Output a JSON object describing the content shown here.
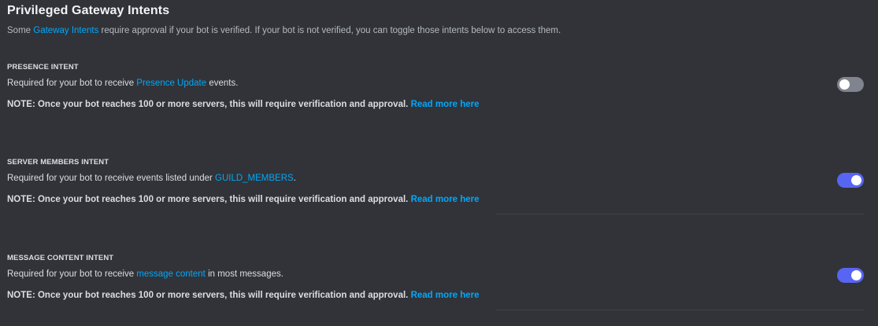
{
  "section": {
    "title": "Privileged Gateway Intents",
    "subtitle_before": "Some ",
    "subtitle_link": "Gateway Intents",
    "subtitle_after": " require approval if your bot is verified. If your bot is not verified, you can toggle those intents below to access them."
  },
  "intents": [
    {
      "heading": "PRESENCE INTENT",
      "desc_before": "Required for your bot to receive ",
      "desc_link": "Presence Update",
      "desc_after": " events.",
      "note": "NOTE: Once your bot reaches 100 or more servers, this will require verification and approval.",
      "read_more": "Read more here",
      "enabled": false
    },
    {
      "heading": "SERVER MEMBERS INTENT",
      "desc_before": "Required for your bot to receive events listed under ",
      "desc_link": "GUILD_MEMBERS",
      "desc_after": ".",
      "note": "NOTE: Once your bot reaches 100 or more servers, this will require verification and approval.",
      "read_more": "Read more here",
      "enabled": true
    },
    {
      "heading": "MESSAGE CONTENT INTENT",
      "desc_before": "Required for your bot to receive ",
      "desc_link": "message content",
      "desc_after": " in most messages.",
      "note": "NOTE: Once your bot reaches 100 or more servers, this will require verification and approval.",
      "read_more": "Read more here",
      "enabled": true
    }
  ],
  "colors": {
    "background": "#313338",
    "link": "#00a8fc",
    "toggle_on": "#5865f2",
    "toggle_off": "#80848e"
  }
}
